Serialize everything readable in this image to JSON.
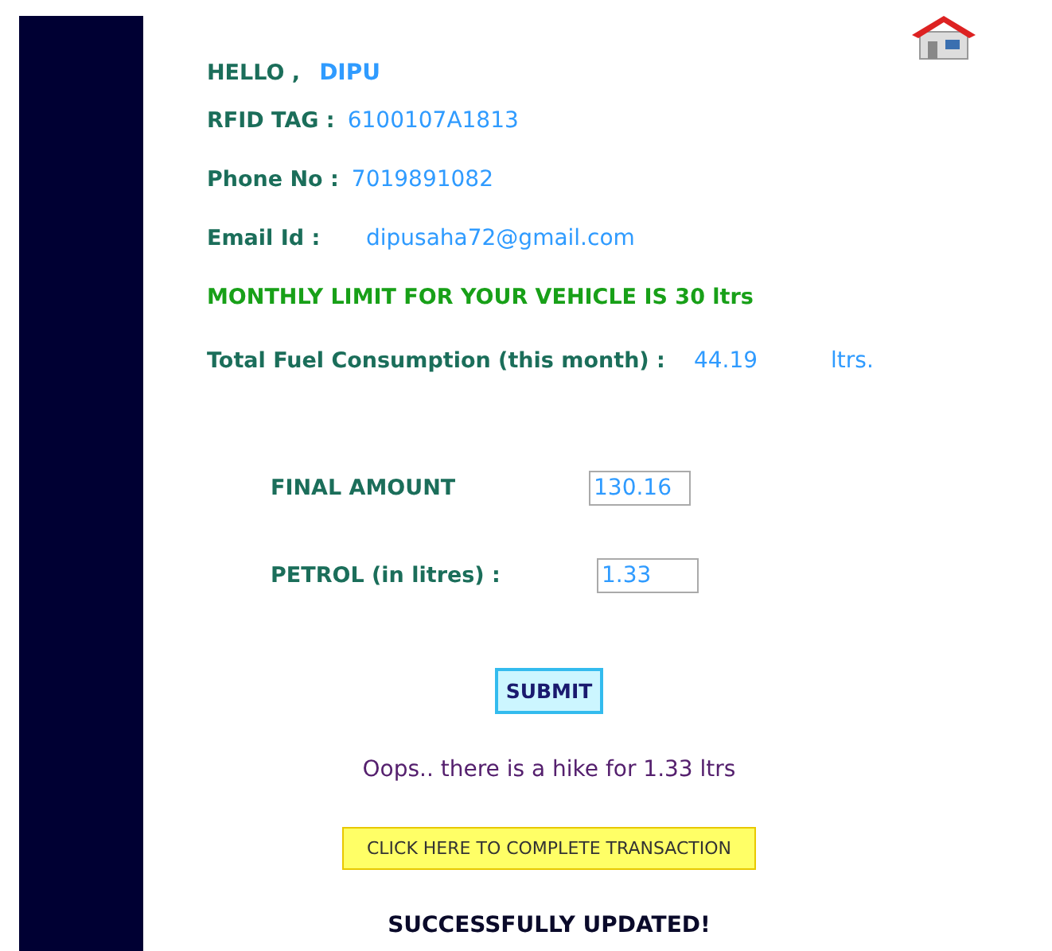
{
  "greeting": {
    "label": "HELLO ,",
    "name": "DIPU"
  },
  "details": [
    {
      "label": "RFID TAG :",
      "value": "6100107A1813"
    },
    {
      "label": "Phone No :",
      "value": "7019891082"
    },
    {
      "label": "Email Id :",
      "value": "dipusaha72@gmail.com"
    }
  ],
  "limit_notice": "MONTHLY LIMIT FOR YOUR VEHICLE IS 30 ltrs",
  "consumption": {
    "label": "Total Fuel Consumption (this month) :",
    "value": "44.19",
    "unit": "ltrs."
  },
  "form": [
    {
      "label": "FINAL AMOUNT",
      "value": "130.16"
    },
    {
      "label": "PETROL (in litres) :",
      "value": "1.33"
    }
  ],
  "submit_button": "SUBMIT",
  "hike_message": "Oops.. there is a hike for 1.33 ltrs",
  "transaction_button": "CLICK HERE TO COMPLETE TRANSACTION",
  "status_message": "SUCCESSFULLY UPDATED!"
}
